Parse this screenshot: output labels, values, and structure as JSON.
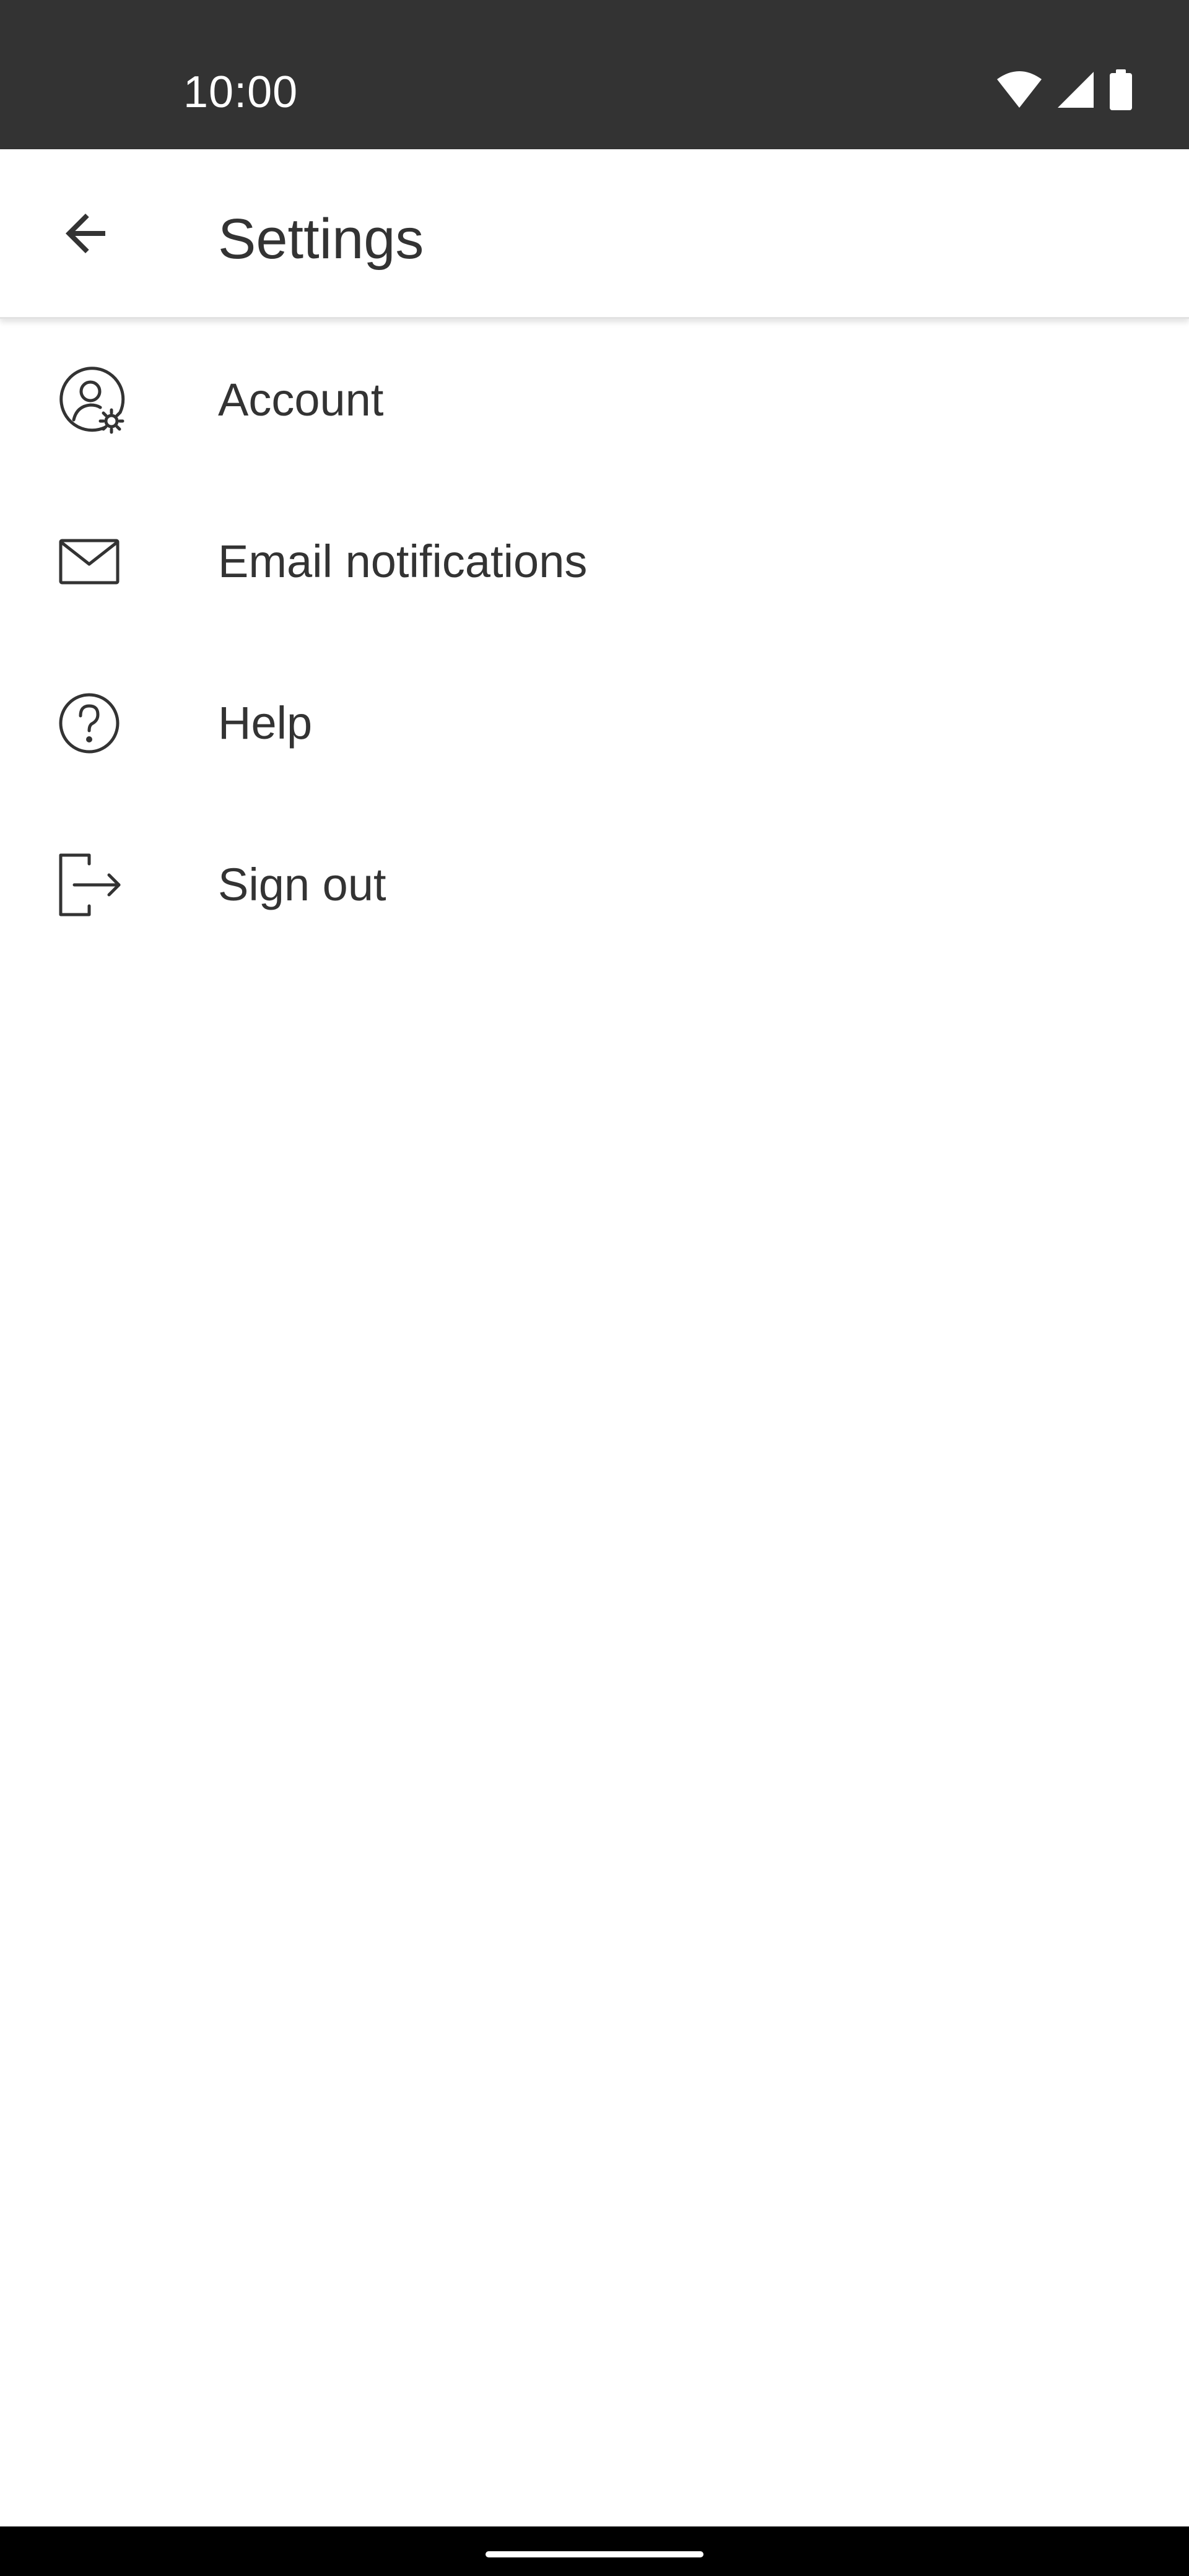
{
  "status_bar": {
    "time": "10:00",
    "icons": [
      "wifi-icon",
      "cellular-signal-icon",
      "battery-icon"
    ]
  },
  "app_bar": {
    "title": "Settings",
    "back_icon": "arrow-left-icon"
  },
  "menu": {
    "items": [
      {
        "label": "Account",
        "icon": "account-settings-icon"
      },
      {
        "label": "Email notifications",
        "icon": "mail-icon"
      },
      {
        "label": "Help",
        "icon": "help-circle-icon"
      },
      {
        "label": "Sign out",
        "icon": "sign-out-icon"
      }
    ]
  },
  "colors": {
    "status_bar_bg": "#333333",
    "text_primary": "#333333",
    "background": "#ffffff",
    "nav_bar_bg": "#000000"
  }
}
